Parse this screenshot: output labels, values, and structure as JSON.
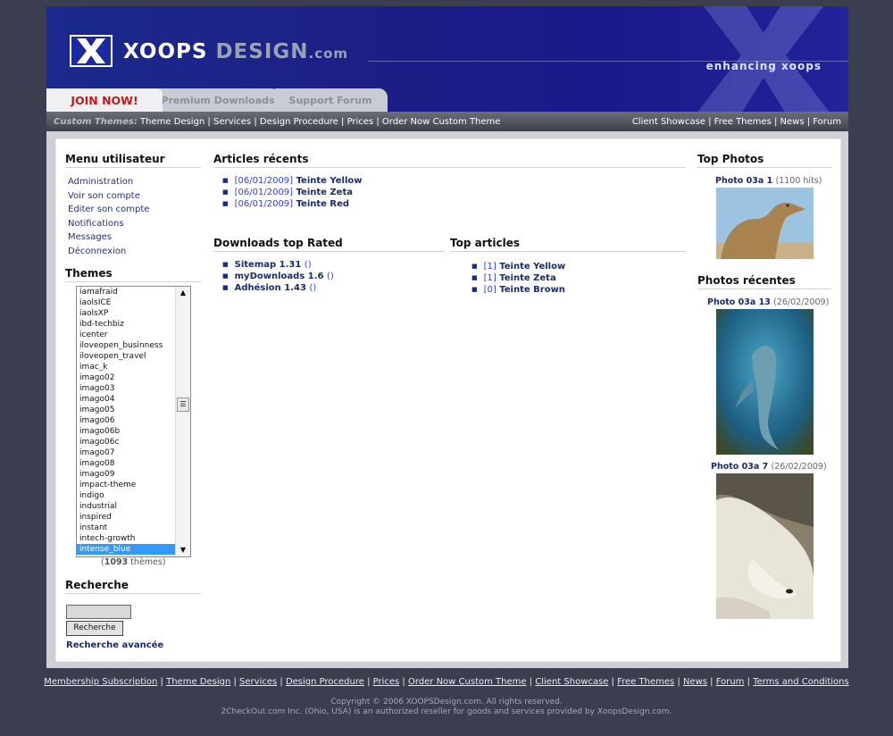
{
  "header": {
    "logo_xoops": "XOOPS",
    "logo_design": "DESIGN",
    "logo_com": ".com",
    "tagline": "enhancing xoops",
    "tabs": [
      "JOIN NOW!",
      "Premium Downloads",
      "Support Forum"
    ]
  },
  "nav": {
    "label": "Custom Themes:",
    "left_links": [
      "Theme Design",
      "Services",
      "Design Procedure",
      "Prices",
      "Order Now Custom Theme"
    ],
    "right_links": [
      "Client Showcase",
      "Free Themes",
      "News",
      "Forum"
    ]
  },
  "sidebar": {
    "menu_title": "Menu utilisateur",
    "menu_items": [
      "Administration",
      "Voir son compte",
      "Editer son compte",
      "Notifications",
      "Messages",
      "Déconnexion"
    ],
    "themes_title": "Themes",
    "themes_list": [
      "iamafraid",
      "iaolsICE",
      "iaolsXP",
      "ibd-techbiz",
      "icenter",
      "iloveopen_businness",
      "iloveopen_travel",
      "imac_k",
      "imago02",
      "imago03",
      "imago04",
      "imago05",
      "imago06",
      "imago06b",
      "imago06c",
      "imago07",
      "imago08",
      "imago09",
      "impact-theme",
      "indigo",
      "industrial",
      "inspired",
      "instant",
      "intech-growth",
      "intense_blue"
    ],
    "themes_selected": "intense_blue",
    "themes_count": "1093",
    "themes_count_suffix": "thèmes",
    "search_title": "Recherche",
    "search_button": "Recherche",
    "search_advanced": "Recherche avancée"
  },
  "articles": {
    "title": "Articles récents",
    "items": [
      {
        "date": "[06/01/2009]",
        "title": "Teinte Yellow"
      },
      {
        "date": "[06/01/2009]",
        "title": "Teinte Zeta"
      },
      {
        "date": "[06/01/2009]",
        "title": "Teinte Red"
      }
    ]
  },
  "downloads": {
    "title": "Downloads top Rated",
    "items": [
      {
        "name": "Sitemap 1.31",
        "count": "()"
      },
      {
        "name": "myDownloads 1.6",
        "count": "()"
      },
      {
        "name": "Adhésion 1.43",
        "count": "()"
      }
    ]
  },
  "top_articles": {
    "title": "Top articles",
    "items": [
      {
        "count": "[1]",
        "title": "Teinte Yellow"
      },
      {
        "count": "[1]",
        "title": "Teinte Zeta"
      },
      {
        "count": "[0]",
        "title": "Teinte Brown"
      }
    ]
  },
  "top_photos": {
    "title": "Top Photos",
    "caption": "Photo 03a 1",
    "meta": "(1100 hits)"
  },
  "recent_photos": {
    "title": "Photos récentes",
    "items": [
      {
        "caption": "Photo 03a 13",
        "meta": "(26/02/2009)"
      },
      {
        "caption": "Photo 03a 7",
        "meta": "(26/02/2009)"
      }
    ]
  },
  "footer": {
    "links": [
      "Membership Subscription",
      "Theme Design",
      "Services",
      "Design Procedure",
      "Prices",
      "Order Now Custom Theme",
      "Client Showcase",
      "Free Themes",
      "News",
      "Forum",
      "Terms and Conditions"
    ],
    "copyright": "Copyright © 2006 XOOPSDesign.com. All rights reserved.",
    "reseller": "2CheckOut.com Inc. (Ohio, USA) is an authorized reseller for goods and services provided by XoopsDesign.com."
  }
}
